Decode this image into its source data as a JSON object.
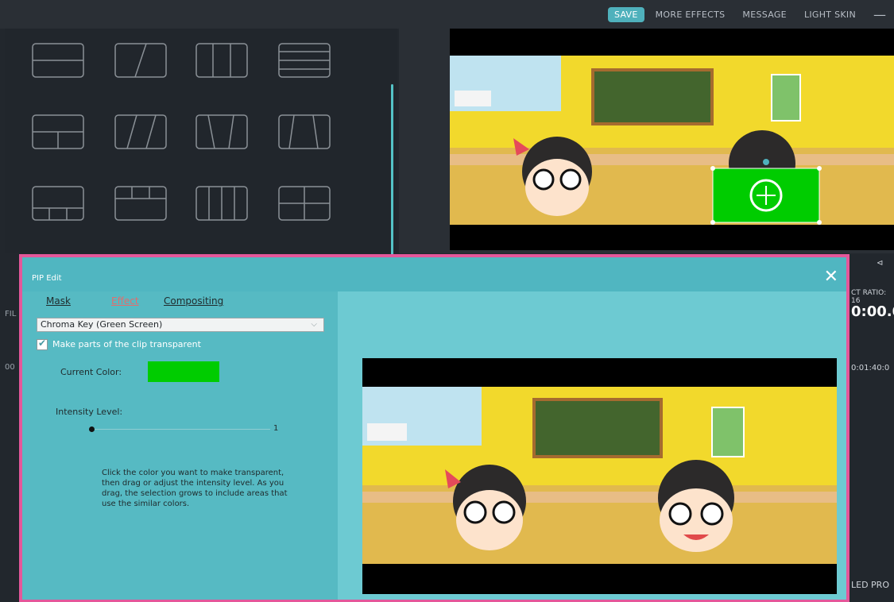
{
  "topbar": {
    "save_label": "SAVE",
    "links": [
      "MORE EFFECTS",
      "MESSAGE",
      "LIGHT SKIN"
    ],
    "minimize_label": "—"
  },
  "dialog": {
    "title": "PIP Edit",
    "close_label": "✕",
    "tabs": [
      {
        "label": "Mask",
        "active": false
      },
      {
        "label": "Effect",
        "active": true
      },
      {
        "label": "Compositing",
        "active": false
      }
    ],
    "effect_select": {
      "value": "Chroma Key (Green Screen)"
    },
    "transparent_checkbox": {
      "checked": true,
      "label": "Make parts of the clip transparent"
    },
    "current_color_label": "Current Color:",
    "current_color_value": "#00cc00",
    "intensity_label": "Intensity Level:",
    "intensity_value": "1",
    "help_text": "Click the color you want to make transparent, then drag or adjust the intensity level. As you drag, the selection grows to include areas that use the similar colors."
  },
  "background_fragments": {
    "right_top": "⊲",
    "aspect_ratio": "CT RATIO: 16",
    "time_current": "0:00.0",
    "time_end": "0:01:40:0",
    "bottom_right": "LED PRO",
    "left_fil": "FIL",
    "left_00": "00"
  },
  "colors": {
    "accent": "#4fb1bc",
    "frame_border": "#e4579a",
    "dialog_bg": "#5fc3cc",
    "chroma_green": "#00cc00"
  }
}
